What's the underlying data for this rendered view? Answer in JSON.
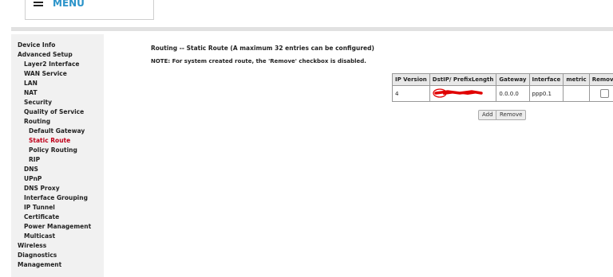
{
  "header": {
    "menu_label": "MENU"
  },
  "sidebar": {
    "items": [
      {
        "label": "Device Info",
        "level": 0,
        "active": false
      },
      {
        "label": "Advanced Setup",
        "level": 0,
        "active": false
      },
      {
        "label": "Layer2 Interface",
        "level": 1,
        "active": false
      },
      {
        "label": "WAN Service",
        "level": 1,
        "active": false
      },
      {
        "label": "LAN",
        "level": 1,
        "active": false
      },
      {
        "label": "NAT",
        "level": 1,
        "active": false
      },
      {
        "label": "Security",
        "level": 1,
        "active": false
      },
      {
        "label": "Quality of Service",
        "level": 1,
        "active": false
      },
      {
        "label": "Routing",
        "level": 1,
        "active": false
      },
      {
        "label": "Default Gateway",
        "level": 2,
        "active": false
      },
      {
        "label": "Static Route",
        "level": 2,
        "active": true
      },
      {
        "label": "Policy Routing",
        "level": 2,
        "active": false
      },
      {
        "label": "RIP",
        "level": 2,
        "active": false
      },
      {
        "label": "DNS",
        "level": 1,
        "active": false
      },
      {
        "label": "UPnP",
        "level": 1,
        "active": false
      },
      {
        "label": "DNS Proxy",
        "level": 1,
        "active": false
      },
      {
        "label": "Interface Grouping",
        "level": 1,
        "active": false
      },
      {
        "label": "IP Tunnel",
        "level": 1,
        "active": false
      },
      {
        "label": "Certificate",
        "level": 1,
        "active": false
      },
      {
        "label": "Power Management",
        "level": 1,
        "active": false
      },
      {
        "label": "Multicast",
        "level": 1,
        "active": false
      },
      {
        "label": "Wireless",
        "level": 0,
        "active": false
      },
      {
        "label": "Diagnostics",
        "level": 0,
        "active": false
      },
      {
        "label": "Management",
        "level": 0,
        "active": false
      }
    ]
  },
  "main": {
    "title": "Routing -- Static Route (A maximum 32 entries can be configured)",
    "note": "NOTE: For system created route, the 'Remove' checkbox is disabled.",
    "table": {
      "headers": [
        "IP Version",
        "DstIP/ PrefixLength",
        "Gateway",
        "Interface",
        "metric",
        "Remove"
      ],
      "rows": [
        {
          "ip_version": "4",
          "dst": "",
          "gateway": "0.0.0.0",
          "interface": "ppp0.1",
          "metric": "",
          "remove_checked": false
        }
      ]
    },
    "buttons": {
      "add": "Add",
      "remove": "Remove"
    }
  },
  "colors": {
    "menu_accent": "#2a93c9",
    "active_nav": "#c0001a",
    "redaction": "#e00000"
  }
}
